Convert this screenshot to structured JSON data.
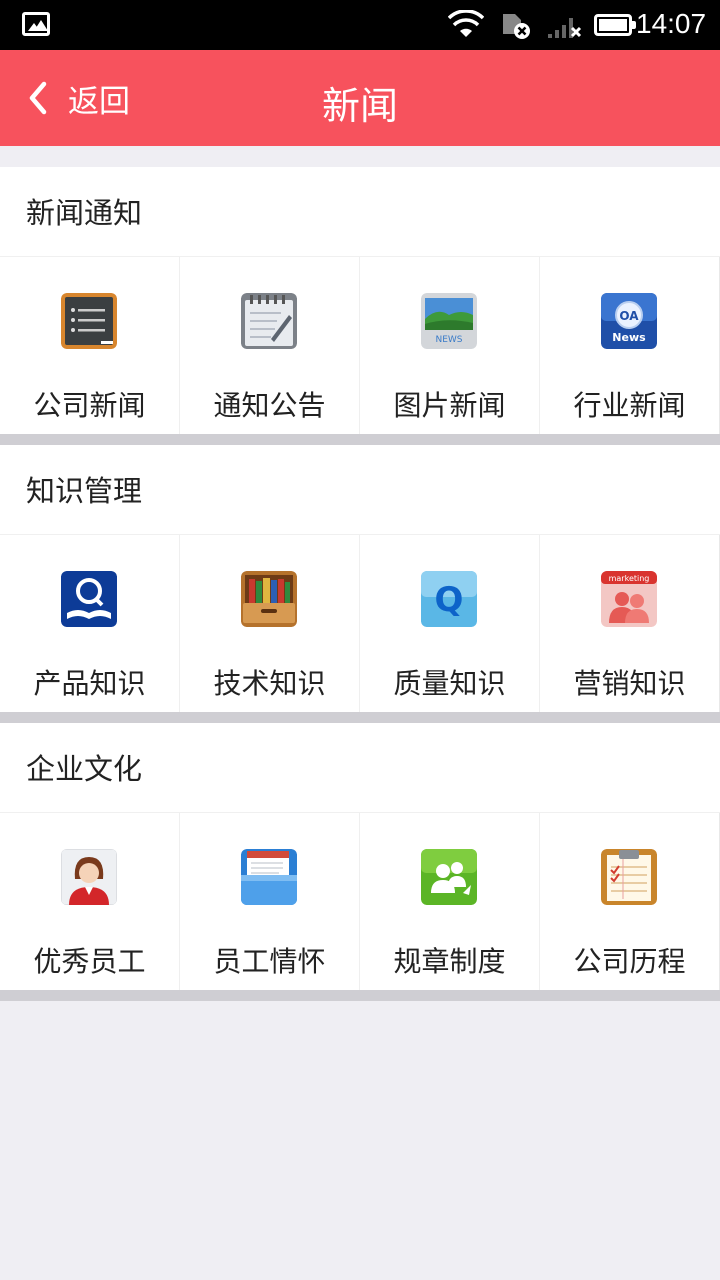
{
  "status_bar": {
    "time": "14:07",
    "icons": [
      "gallery-icon",
      "wifi-icon",
      "sim-error-icon",
      "no-signal-icon",
      "battery-icon"
    ]
  },
  "header": {
    "back_label": "返回",
    "title": "新闻",
    "color": "#f7525d"
  },
  "sections": [
    {
      "title": "新闻通知",
      "items": [
        {
          "label": "公司新闻",
          "icon": "chalkboard-icon"
        },
        {
          "label": "通知公告",
          "icon": "notepad-icon"
        },
        {
          "label": "图片新闻",
          "icon": "picture-news-icon"
        },
        {
          "label": "行业新闻",
          "icon": "oa-news-icon"
        }
      ]
    },
    {
      "title": "知识管理",
      "items": [
        {
          "label": "产品知识",
          "icon": "search-book-icon"
        },
        {
          "label": "技术知识",
          "icon": "bookshelf-icon"
        },
        {
          "label": "质量知识",
          "icon": "q-icon"
        },
        {
          "label": "营销知识",
          "icon": "marketing-people-icon"
        }
      ]
    },
    {
      "title": "企业文化",
      "items": [
        {
          "label": "优秀员工",
          "icon": "employee-avatar-icon"
        },
        {
          "label": "员工情怀",
          "icon": "folder-document-icon"
        },
        {
          "label": "规章制度",
          "icon": "chat-people-icon"
        },
        {
          "label": "公司历程",
          "icon": "clipboard-checklist-icon"
        }
      ]
    }
  ]
}
